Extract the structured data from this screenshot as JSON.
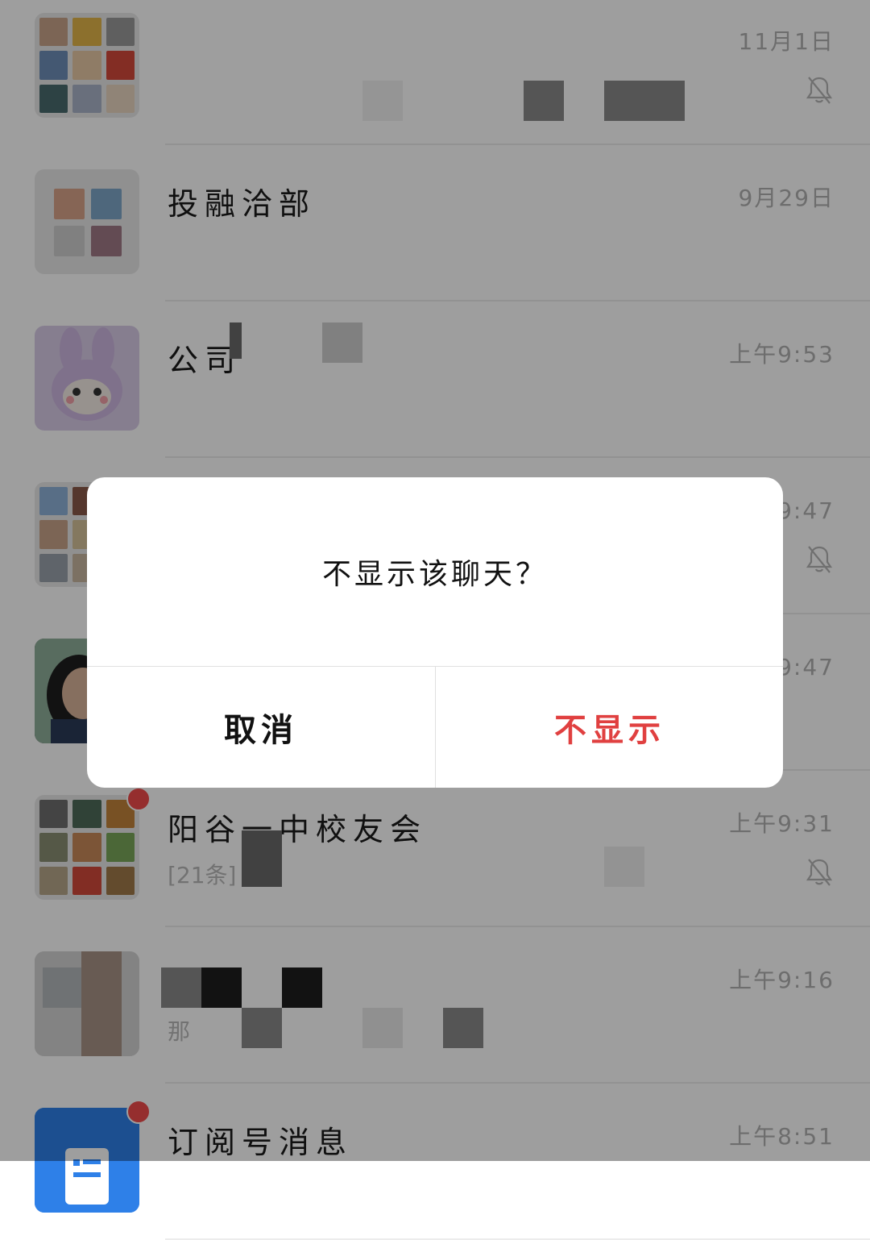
{
  "chats": [
    {
      "name": "",
      "preview": "",
      "time": "11月1日",
      "muted": true,
      "badge": false,
      "avatar": "grid9",
      "colors": [
        "#c9a38a",
        "#e2b54a",
        "#9a9a9a",
        "#6f8fb8",
        "#e7c9a5",
        "#d34a3a",
        "#4a6b6e",
        "#aab4c8",
        "#e8d6c0"
      ]
    },
    {
      "name": "投融洽部",
      "preview": "",
      "time": "9月29日",
      "muted": false,
      "badge": false,
      "avatar": "grid4",
      "colors": [
        "#d9a48a",
        "#7fa7c9",
        "#cfcfcf",
        "#a07a86"
      ]
    },
    {
      "name": "公司",
      "preview": "",
      "time": "上午9:53",
      "muted": false,
      "badge": false,
      "avatar": "bunny",
      "colors": [
        "#d9cbe7"
      ]
    },
    {
      "name": "",
      "preview": "",
      "time": "上午9:47",
      "muted": true,
      "badge": false,
      "avatar": "grid9",
      "colors": [
        "#8fb2d8",
        "#8a5a4a",
        "#e8e8e8",
        "#c8a48a",
        "#d5c29a",
        "#f0f0f0",
        "#9aa2ab",
        "#c9b7a0",
        "#5a4a3a"
      ]
    },
    {
      "name": "",
      "preview": "",
      "time": "上午9:47",
      "muted": false,
      "badge": false,
      "avatar": "photo",
      "colors": [
        "#3a3a3a"
      ]
    },
    {
      "name": "阳谷一中校友会",
      "preview": "[21条]",
      "time": "上午9:31",
      "muted": true,
      "badge": true,
      "avatar": "grid9",
      "colors": [
        "#6f6f6f",
        "#4e6b5a",
        "#c2843a",
        "#8a8f73",
        "#c98a5a",
        "#7aa65a",
        "#b7a78a",
        "#d24a3a",
        "#a07a4a"
      ]
    },
    {
      "name": "",
      "preview": "那",
      "time": "上午9:16",
      "muted": false,
      "badge": false,
      "avatar": "photo",
      "colors": [
        "#cfcfcf"
      ]
    },
    {
      "name": "订阅号消息",
      "preview": "",
      "time": "上午8:51",
      "muted": false,
      "badge": true,
      "avatar": "subscribe",
      "colors": [
        "#2e80e8"
      ]
    }
  ],
  "dialog": {
    "message": "不显示该聊天？",
    "cancel_label": "取消",
    "confirm_label": "不显示"
  }
}
